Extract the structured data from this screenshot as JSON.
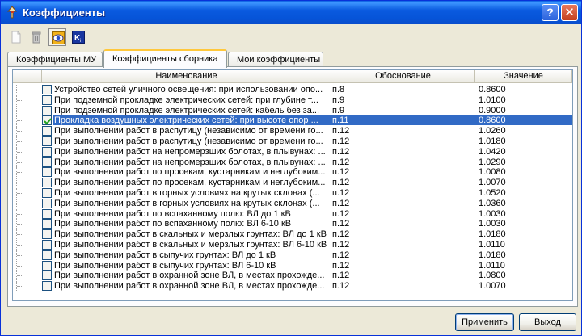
{
  "window": {
    "title": "Коэффициенты",
    "help_label": "?",
    "close_label": "✕"
  },
  "tabs": [
    {
      "label": "Коэффициенты МУ"
    },
    {
      "label": "Коэффициенты сборника"
    },
    {
      "label": "Мои коэффициенты"
    }
  ],
  "table": {
    "columns": [
      "Наименование",
      "Обоснование",
      "Значение"
    ],
    "rows": [
      {
        "name": "Устройство сетей уличного освещения: при использовании опо...",
        "basis": "п.8",
        "value": "0.8600",
        "checked": false
      },
      {
        "name": "При подземной прокладке электрических сетей: при глубине т...",
        "basis": "п.9",
        "value": "1.0100",
        "checked": false
      },
      {
        "name": "При подземной прокладке электрических сетей: кабель без за...",
        "basis": "п.9",
        "value": "0.9000",
        "checked": false
      },
      {
        "name": "Прокладка воздушных электрических сетей: при высоте опор ...",
        "basis": "п.11",
        "value": "0.8600",
        "checked": true
      },
      {
        "name": "При выполнении работ в распутицу (независимо от времени го...",
        "basis": "п.12",
        "value": "1.0260",
        "checked": false
      },
      {
        "name": "При выполнении работ в распутицу (независимо от времени го...",
        "basis": "п.12",
        "value": "1.0180",
        "checked": false
      },
      {
        "name": "При выполнении работ на непромерзших болотах, в плывунах: ...",
        "basis": "п.12",
        "value": "1.0420",
        "checked": false
      },
      {
        "name": "При выполнении работ на непромерзших болотах, в плывунах: ...",
        "basis": "п.12",
        "value": "1.0290",
        "checked": false
      },
      {
        "name": "При выполнении работ по просекам, кустарникам и неглубоким...",
        "basis": "п.12",
        "value": "1.0080",
        "checked": false
      },
      {
        "name": "При выполнении работ по просекам, кустарникам и неглубоким...",
        "basis": "п.12",
        "value": "1.0070",
        "checked": false
      },
      {
        "name": "При выполнении работ в горных условиях на крутых склонах (...",
        "basis": "п.12",
        "value": "1.0520",
        "checked": false
      },
      {
        "name": "При выполнении работ в горных условиях на крутых склонах (...",
        "basis": "п.12",
        "value": "1.0360",
        "checked": false
      },
      {
        "name": "При выполнении работ по вспаханному полю: ВЛ до 1 кВ",
        "basis": "п.12",
        "value": "1.0030",
        "checked": false
      },
      {
        "name": "При выполнении работ по вспаханному полю: ВЛ 6-10 кВ",
        "basis": "п.12",
        "value": "1.0030",
        "checked": false
      },
      {
        "name": "При выполнении работ в скальных и мерзлых грунтах: ВЛ до 1 кВ",
        "basis": "п.12",
        "value": "1.0180",
        "checked": false
      },
      {
        "name": "При выполнении работ в скальных и мерзлых грунтах: ВЛ 6-10 кВ",
        "basis": "п.12",
        "value": "1.0110",
        "checked": false
      },
      {
        "name": "При выполнении работ в сыпучих грунтах: ВЛ до 1 кВ",
        "basis": "п.12",
        "value": "1.0180",
        "checked": false
      },
      {
        "name": "При выполнении работ в сыпучих грунтах: ВЛ 6-10 кВ",
        "basis": "п.12",
        "value": "1.0110",
        "checked": false
      },
      {
        "name": "При выполнении работ в охранной зоне ВЛ, в местах прохожде...",
        "basis": "п.12",
        "value": "1.0800",
        "checked": false
      },
      {
        "name": "При выполнении работ в охранной зоне ВЛ, в местах прохожде...",
        "basis": "п.12",
        "value": "1.0070",
        "checked": false
      }
    ]
  },
  "buttons": {
    "apply": "Применить",
    "exit": "Выход"
  },
  "colors": {
    "titlebar": "#0a5adf",
    "selection": "#316ac5",
    "active_tab_accent": "#ffc83c"
  }
}
